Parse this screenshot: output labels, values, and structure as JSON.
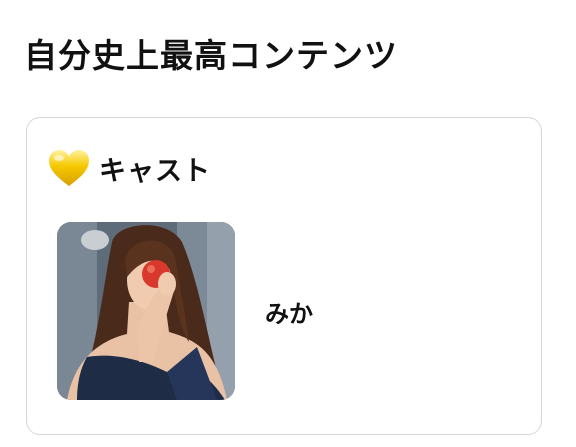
{
  "page_title": "自分史上最高コンテンツ",
  "cast_section": {
    "icon": "yellow-heart-icon",
    "title": "キャスト",
    "items": [
      {
        "name": "みか",
        "photo": "cast-photo-mika"
      }
    ]
  },
  "colors": {
    "card_border": "#d6d6d6",
    "heart": "#f2c200",
    "text": "#111111"
  }
}
